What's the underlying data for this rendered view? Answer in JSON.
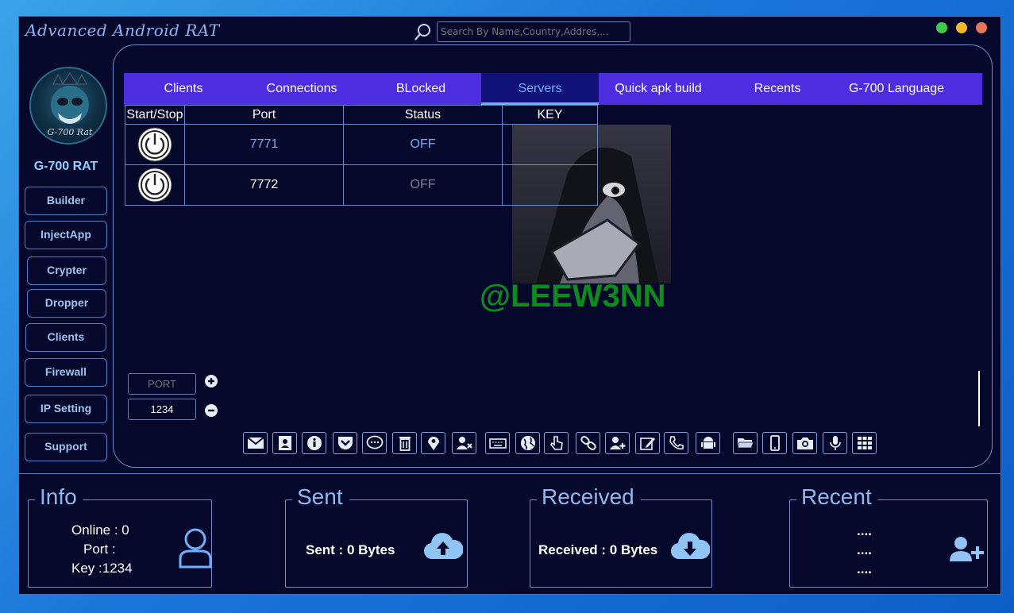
{
  "window": {
    "title": "Advanced Android RAT"
  },
  "search": {
    "placeholder": "Search By Name,Country,Addres,..."
  },
  "sidebar": {
    "brand": "G-700 RAT",
    "avatar_text": "G-700 Rat",
    "items": [
      {
        "label": "Builder"
      },
      {
        "label": "InjectApp"
      },
      {
        "label": "Crypter"
      },
      {
        "label": "Dropper"
      },
      {
        "label": "Clients"
      },
      {
        "label": "Firewall"
      },
      {
        "label": "IP Setting"
      },
      {
        "label": "Support"
      }
    ]
  },
  "tabs": [
    {
      "label": "Clients"
    },
    {
      "label": "Connections"
    },
    {
      "label": "BLocked"
    },
    {
      "label": "Servers"
    },
    {
      "label": "Quick apk build"
    },
    {
      "label": "Recents"
    },
    {
      "label": "G-700 Language"
    }
  ],
  "active_tab": "Servers",
  "servers": {
    "columns": [
      "Start/Stop",
      "Port",
      "Status",
      "KEY"
    ],
    "rows": [
      {
        "port": "7771",
        "status": "OFF",
        "key": ""
      },
      {
        "port": "7772",
        "status": "OFF",
        "key": ""
      }
    ]
  },
  "watermark": "@LEEW3NN",
  "port_input": {
    "placeholder": "PORT",
    "value": "1234"
  },
  "toolbar_icons": [
    "mail-icon",
    "contacts-icon",
    "info-icon",
    "pocket-icon",
    "chat-icon",
    "trash-icon",
    "location-icon",
    "remove-user-icon",
    "keyboard-icon",
    "globe-icon",
    "touch-icon",
    "link-icon",
    "add-user-icon",
    "edit-icon",
    "phone-icon",
    "android-icon",
    "folder-icon",
    "mobile-icon",
    "camera-icon",
    "microphone-icon",
    "apps-icon"
  ],
  "info": {
    "title": "Info",
    "online": "Online : 0",
    "port": "Port :",
    "key": "Key :1234"
  },
  "sent": {
    "title": "Sent",
    "text": "Sent : 0 Bytes"
  },
  "received": {
    "title": "Received",
    "text": "Received : 0 Bytes"
  },
  "recent": {
    "title": "Recent",
    "lines": [
      "....",
      "....",
      "...."
    ]
  },
  "colors": {
    "accent": "#4c2de0",
    "background": "#05082a",
    "active_tab": "#10127a",
    "watermark": "#0f8a1f"
  }
}
